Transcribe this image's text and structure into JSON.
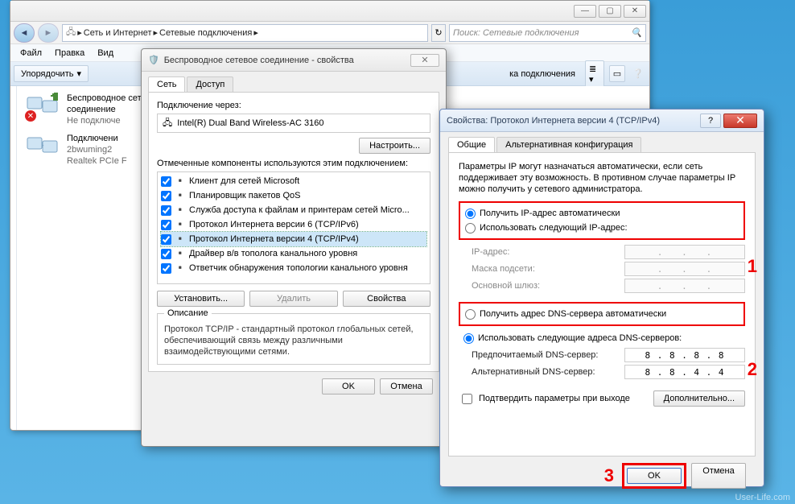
{
  "explorer": {
    "breadcrumb": [
      "Сеть и Интернет",
      "Сетевые подключения"
    ],
    "search_placeholder": "Поиск: Сетевые подключения",
    "menu": [
      "Файл",
      "Правка",
      "Вид"
    ],
    "toolbar": {
      "organize": "Упорядочить"
    },
    "extra_tool": "ка подключения",
    "items": [
      {
        "title": "Беспроводное сетевое соединение",
        "line2": "Не подключе",
        "error": true
      },
      {
        "title": "Подключени",
        "line2": "2bwuming2",
        "line3": "Realtek PCIe F",
        "error": false
      }
    ]
  },
  "dlg1": {
    "title": "Беспроводное сетевое соединение - свойства",
    "tabs": [
      "Сеть",
      "Доступ"
    ],
    "connect_via": "Подключение через:",
    "adapter": "Intel(R) Dual Band Wireless-AC 3160",
    "configure": "Настроить...",
    "components_label": "Отмеченные компоненты используются этим подключением:",
    "components": [
      "Клиент для сетей Microsoft",
      "Планировщик пакетов QoS",
      "Служба доступа к файлам и принтерам сетей Micro...",
      "Протокол Интернета версии 6 (TCP/IPv6)",
      "Протокол Интернета версии 4 (TCP/IPv4)",
      "Драйвер в/в тополога канального уровня",
      "Ответчик обнаружения топологии канального уровня"
    ],
    "selected_index": 4,
    "install": "Установить...",
    "remove": "Удалить",
    "properties": "Свойства",
    "desc_title": "Описание",
    "desc_text": "Протокол TCP/IP - стандартный протокол глобальных сетей, обеспечивающий связь между различными взаимодействующими сетями.",
    "ok": "OK",
    "cancel": "Отмена"
  },
  "dlg2": {
    "title": "Свойства: Протокол Интернета версии 4 (TCP/IPv4)",
    "tabs": [
      "Общие",
      "Альтернативная конфигурация"
    ],
    "info": "Параметры IP могут назначаться автоматически, если сеть поддерживает эту возможность. В противном случае параметры IP можно получить у сетевого администратора.",
    "ip_auto": "Получить IP-адрес автоматически",
    "ip_manual": "Использовать следующий IP-адрес:",
    "ip_label": "IP-адрес:",
    "mask_label": "Маска подсети:",
    "gw_label": "Основной шлюз:",
    "dns_auto": "Получить адрес DNS-сервера автоматически",
    "dns_manual": "Использовать следующие адреса DNS-серверов:",
    "dns1_label": "Предпочитаемый DNS-сервер:",
    "dns2_label": "Альтернативный DNS-сервер:",
    "dns1_value": "8 . 8 . 8 . 8",
    "dns2_value": "8 . 8 . 4 . 4",
    "confirm": "Подтвердить параметры при выходе",
    "advanced": "Дополнительно...",
    "ok": "OK",
    "cancel": "Отмена",
    "annot1": "1",
    "annot2": "2",
    "annot3": "3"
  },
  "side_label": "Беспроводное сетевое",
  "watermark": "User-Life.com"
}
